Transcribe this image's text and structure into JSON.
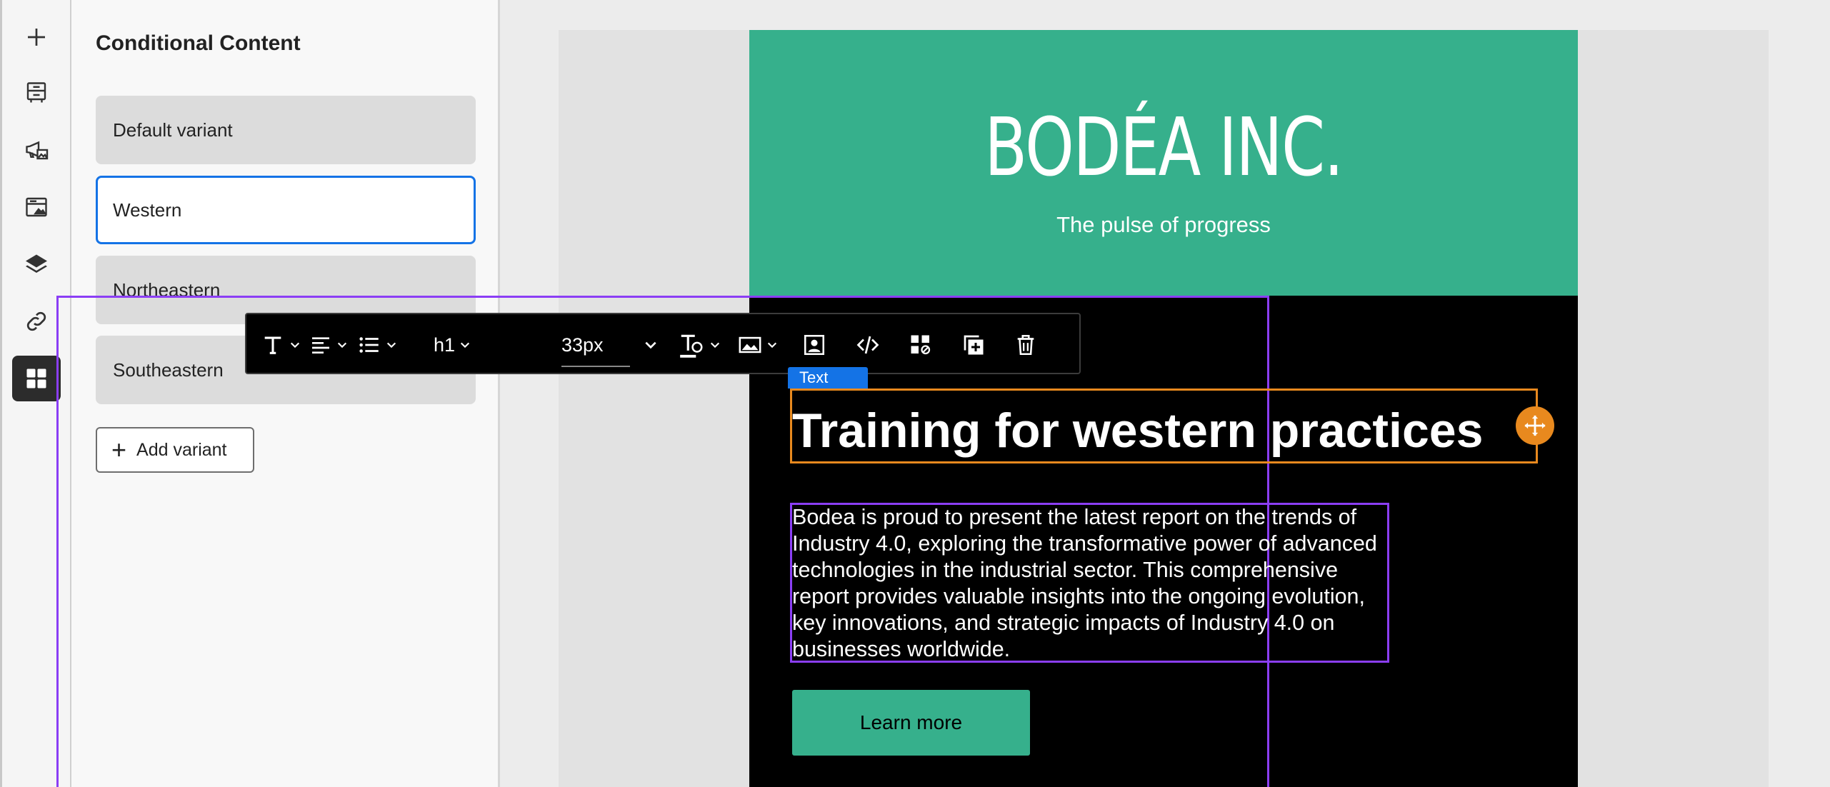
{
  "rail": {
    "items": [
      {
        "name": "add-icon"
      },
      {
        "name": "structure-icon"
      },
      {
        "name": "campaign-assets-icon"
      },
      {
        "name": "fragments-icon"
      },
      {
        "name": "layers-icon"
      },
      {
        "name": "links-icon"
      },
      {
        "name": "conditional-content-icon",
        "active": true
      }
    ]
  },
  "panel": {
    "title": "Conditional Content",
    "variants": [
      {
        "label": "Default variant",
        "selected": false
      },
      {
        "label": "Western",
        "selected": true
      },
      {
        "label": "Northeastern",
        "selected": false
      },
      {
        "label": "Southeastern",
        "selected": false
      }
    ],
    "add_variant_label": "Add variant"
  },
  "email": {
    "brand": "BODÉA INC.",
    "tagline": "The pulse of progress",
    "heading": "Training for western practices",
    "body": "Bodea is proud to present the latest report on the trends of Industry 4.0, exploring the transformative power of advanced technologies in the industrial sector. This comprehensive report provides valuable insights into the ongoing evolution, key innovations, and strategic impacts of Industry 4.0 on businesses worldwide.",
    "cta_label": "Learn more"
  },
  "toolbar": {
    "heading_level": "h1",
    "font_size": "33px",
    "component_badge": "Text"
  },
  "colors": {
    "brand_green": "#36b08c",
    "selection_purple": "#8b3ef5",
    "focus_orange": "#e8891e",
    "accent_blue": "#1473e6"
  }
}
